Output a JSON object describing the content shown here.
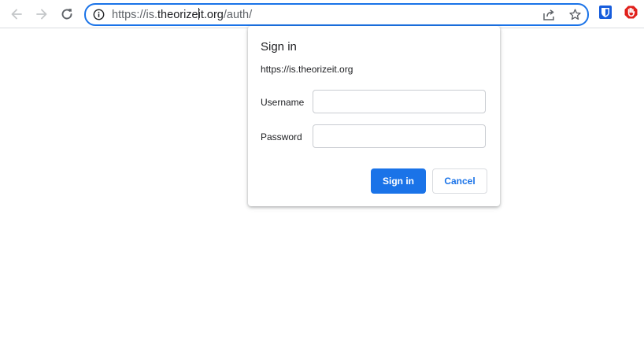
{
  "browser": {
    "url_scheme": "https://is.",
    "url_host_part1": "theorize",
    "url_host_part2": "it.org",
    "url_path": "/auth/",
    "icons": [
      "back-arrow-icon",
      "forward-arrow-icon",
      "reload-icon",
      "info-icon",
      "share-icon",
      "star-icon",
      "bitwarden-extension-icon",
      "adblock-extension-icon"
    ]
  },
  "dialog": {
    "title": "Sign in",
    "origin": "https://is.theorizeit.org",
    "username_label": "Username",
    "username_value": "",
    "password_label": "Password",
    "password_value": "",
    "sign_in_label": "Sign in",
    "cancel_label": "Cancel"
  },
  "colors": {
    "accent": "#1a73e8",
    "adblock_red": "#e0201b",
    "bitwarden_blue": "#175ddc"
  }
}
